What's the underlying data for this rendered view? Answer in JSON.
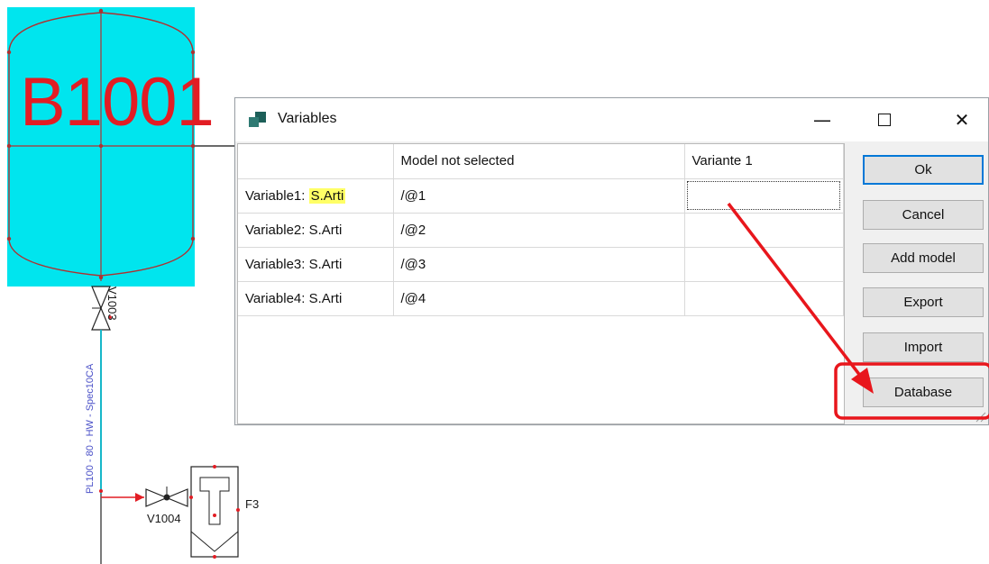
{
  "cad": {
    "tank_label": "B1001",
    "valve_top_label": "V1003",
    "pipe_spec_label": "PL100 - 80 - HW - Spec10CA",
    "valve_bottom_label": "V1004",
    "filter_label": "F3"
  },
  "dialog": {
    "title": "Variables",
    "title_icon": "app-icon",
    "controls": {
      "minimize": "—",
      "close": "✕"
    },
    "table": {
      "headers": [
        "",
        "Model not selected",
        "Variante 1"
      ],
      "rows": [
        {
          "name": "Variable1:",
          "type": "S.Arti",
          "value": "/@1",
          "variant": "",
          "type_highlighted": true
        },
        {
          "name": "Variable2:",
          "type": "S.Arti",
          "value": "/@2",
          "variant": ""
        },
        {
          "name": "Variable3:",
          "type": "S.Arti",
          "value": "/@3",
          "variant": ""
        },
        {
          "name": "Variable4:",
          "type": "S.Arti",
          "value": "/@4",
          "variant": ""
        }
      ]
    },
    "buttons": {
      "ok": "Ok",
      "cancel": "Cancel",
      "add_model": "Add model",
      "export": "Export",
      "import": "Import",
      "database": "Database"
    }
  },
  "colors": {
    "tank_fill": "#00e5ee",
    "tank_text": "#e21d24",
    "annotation": "#e8161c",
    "highlight": "#ffff66",
    "accent": "#0078d7"
  }
}
